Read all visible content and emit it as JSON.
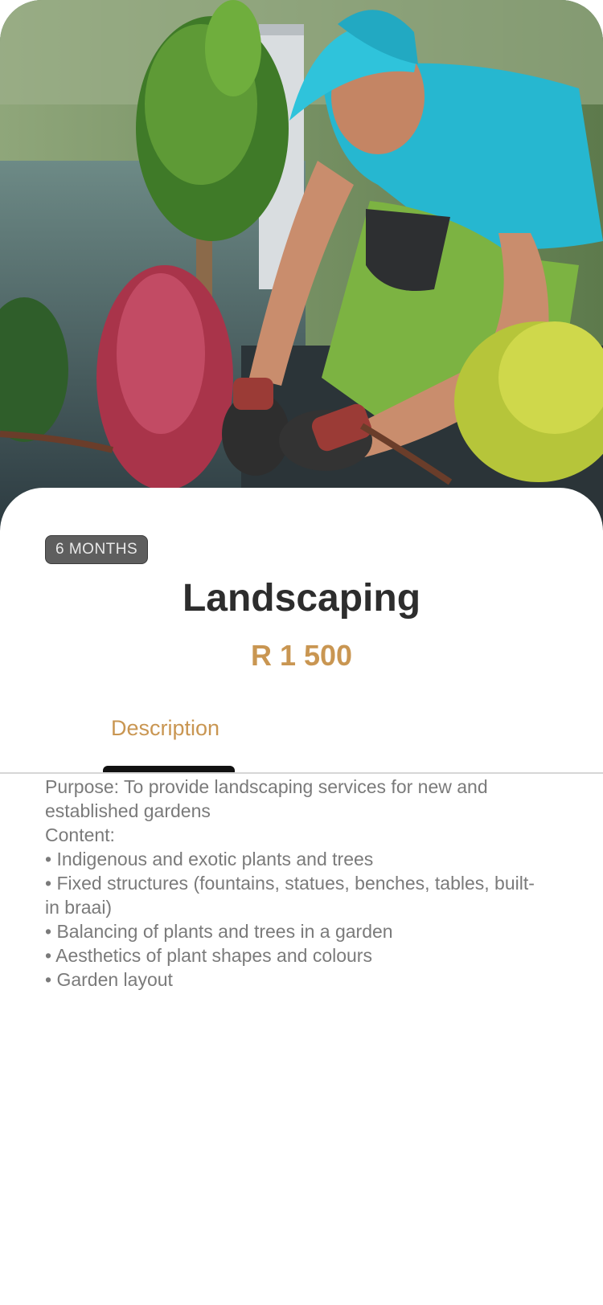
{
  "product": {
    "image_alt": "Landscaper planting shrubs in a garden",
    "duration_badge": "6 MONTHS",
    "title": "Landscaping",
    "price": "R 1 500"
  },
  "tabs": [
    {
      "label": "Description",
      "active": true
    }
  ],
  "description": {
    "lines": [
      "Purpose: To provide landscaping services for new and established gardens",
      "Content:",
      "• Indigenous and exotic plants and trees",
      "• Fixed structures (fountains, statues, benches, tables, built-in braai)",
      "• Balancing of plants and trees in a garden",
      "• Aesthetics of plant shapes and colours",
      "• Garden layout"
    ]
  },
  "colors": {
    "accent": "#c99652",
    "title": "#2d2d2d",
    "body_text": "#7a7a7a",
    "badge_bg": "#5e5e5e",
    "tab_indicator": "#111111"
  }
}
